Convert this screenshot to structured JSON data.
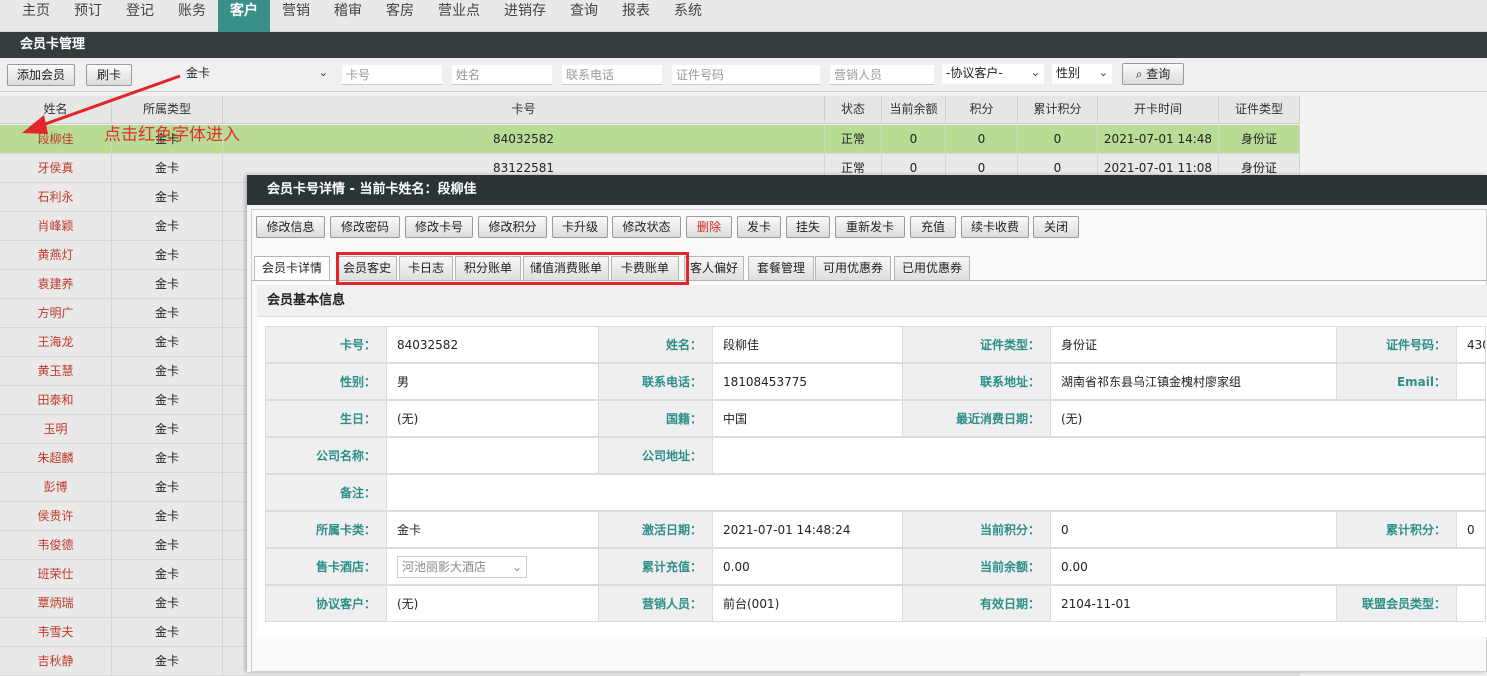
{
  "topnav": [
    "主页",
    "预订",
    "登记",
    "账务",
    "客户",
    "营销",
    "稽审",
    "客房",
    "营业点",
    "进销存",
    "查询",
    "报表",
    "系统"
  ],
  "topnav_active": "客户",
  "section_title": "会员卡管理",
  "toolbar": {
    "add_member": "添加会员",
    "swipe_card": "刷卡",
    "card_type_value": "金卡",
    "card_no_placeholder": "卡号",
    "name_placeholder": "姓名",
    "phone_placeholder": "联系电话",
    "id_no_placeholder": "证件号码",
    "sales_placeholder": "营销人员",
    "agreement_value": "-协议客户-",
    "gender_value": "性别",
    "search_label": "查询"
  },
  "grid": {
    "columns": [
      "姓名",
      "所属类型",
      "卡号",
      "状态",
      "当前余额",
      "积分",
      "累计积分",
      "开卡时间",
      "证件类型"
    ],
    "rows": [
      [
        "段柳佳",
        "金卡",
        "84032582",
        "正常",
        "0",
        "0",
        "0",
        "2021-07-01 14:48",
        "身份证"
      ],
      [
        "牙侯真",
        "金卡",
        "83122581",
        "正常",
        "0",
        "0",
        "0",
        "2021-07-01 11:08",
        "身份证"
      ],
      [
        "石利永",
        "金卡"
      ],
      [
        "肖峰颖",
        "金卡"
      ],
      [
        "黄燕灯",
        "金卡"
      ],
      [
        "袁建养",
        "金卡"
      ],
      [
        "方明广",
        "金卡"
      ],
      [
        "王海龙",
        "金卡"
      ],
      [
        "黄玉慧",
        "金卡"
      ],
      [
        "田泰和",
        "金卡"
      ],
      [
        "玉明",
        "金卡"
      ],
      [
        "朱超麟",
        "金卡"
      ],
      [
        "彭博",
        "金卡"
      ],
      [
        "侯贵许",
        "金卡"
      ],
      [
        "韦俊德",
        "金卡"
      ],
      [
        "班荣仕",
        "金卡"
      ],
      [
        "覃炳瑞",
        "金卡"
      ],
      [
        "韦雪夫",
        "金卡"
      ],
      [
        "吉秋静",
        "金卡"
      ]
    ]
  },
  "annotation": "点击红色字体进入",
  "modal": {
    "title": "会员卡号详情 - 当前卡姓名：段柳佳",
    "actions": [
      "修改信息",
      "修改密码",
      "修改卡号",
      "修改积分",
      "卡升级",
      "修改状态",
      "删除",
      "发卡",
      "挂失",
      "重新发卡",
      "充值",
      "续卡收费",
      "关闭"
    ],
    "delete_color": "#d12a2a",
    "tabs": [
      "会员卡详情",
      "会员客史",
      "卡日志",
      "积分账单",
      "储值消费账单",
      "卡费账单",
      "客人偏好",
      "套餐管理",
      "可用优惠券",
      "已用优惠券"
    ],
    "panel_title": "会员基本信息",
    "info": {
      "card_no_label": "卡号：",
      "card_no": "84032582",
      "name_label": "姓名：",
      "name": "段柳佳",
      "id_type_label": "证件类型：",
      "id_type": "身份证",
      "id_no_label": "证件号码：",
      "id_no": "430",
      "gender_label": "性别：",
      "gender": "男",
      "phone_label": "联系电话：",
      "phone": "18108453775",
      "address_label": "联系地址：",
      "address": "湖南省祁东县乌江镇金槐村廖家组",
      "email_label": "Email：",
      "email": "",
      "birthday_label": "生日：",
      "birthday": "(无)",
      "nationality_label": "国籍：",
      "nationality": "中国",
      "last_consume_label": "最近消费日期：",
      "last_consume": "(无)",
      "company_label": "公司名称：",
      "company": "",
      "company_addr_label": "公司地址：",
      "company_addr": "",
      "remark_label": "备注：",
      "remark": "",
      "card_type_label": "所属卡类：",
      "card_type": "金卡",
      "activate_label": "激活日期：",
      "activate": "2021-07-01 14:48:24",
      "cur_points_label": "当前积分：",
      "cur_points": "0",
      "total_points_label": "累计积分：",
      "total_points": "0",
      "hotel_label": "售卡酒店：",
      "hotel": "河池丽影大酒店",
      "total_recharge_label": "累计充值：",
      "total_recharge": "0.00",
      "balance_label": "当前余额：",
      "balance": "0.00",
      "agreement_label": "协议客户：",
      "agreement": "(无)",
      "sales_label": "营销人员：",
      "sales": "前台(001)",
      "expire_label": "有效日期：",
      "expire": "2104-11-01",
      "alliance_label": "联盟会员类型：",
      "alliance": ""
    }
  }
}
